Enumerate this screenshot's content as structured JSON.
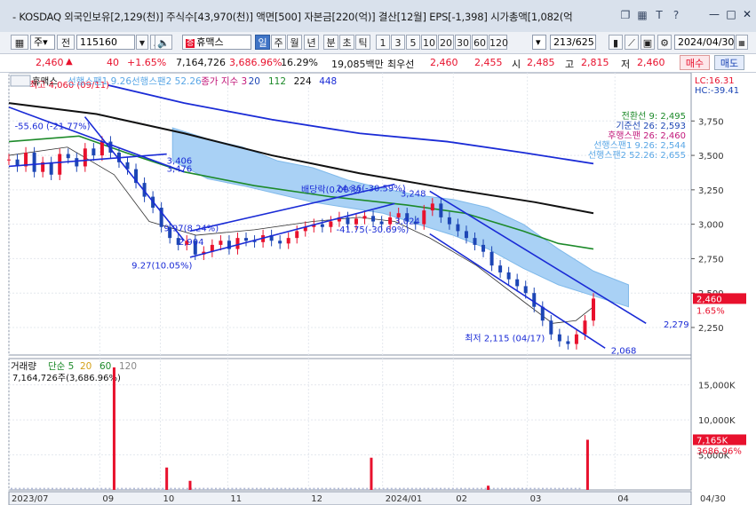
{
  "titlebar": {
    "text": "- KOSDAQ 외국인보유[2,129(천)] 주식수[43,970(천)] 액면[500] 자본금[220(억)] 결산[12월] EPS[-1,398] 시가총액[1,082(억",
    "icons": [
      "window-icon",
      "layout-icon",
      "text-icon",
      "help-icon"
    ]
  },
  "toolbar": {
    "type_select": "주",
    "jeon_label": "전",
    "code_value": "115160",
    "stock_name": "휴맥스",
    "stock_badge": "증",
    "periods": [
      "일",
      "주",
      "월",
      "년",
      "분",
      "초",
      "틱"
    ],
    "selected_period": "일",
    "intervals": [
      "1",
      "3",
      "5",
      "10",
      "20",
      "30",
      "60",
      "120"
    ],
    "counter": "213/625",
    "date_value": "2024/04/30"
  },
  "pricebar": {
    "price": "2,460",
    "change": "40",
    "change_pct": "+1.65%",
    "volume": "7,164,726",
    "vol_ratio": "3,686.96%",
    "turnover": "16.29%",
    "amount": "19,085백만",
    "pref_label": "최우선",
    "ask": "2,460",
    "bid": "2,455",
    "open_label": "시",
    "open": "2,485",
    "high_label": "고",
    "high": "2,815",
    "low_label": "저",
    "low": "2,460",
    "buy_label": "매수",
    "sell_label": "매도"
  },
  "chart_data": [
    {
      "type": "line",
      "title": "휴맥스",
      "legend": [
        "선행스팬1 9.26",
        "선행스팬2 52.26",
        "종가 지수 3",
        "20",
        "112",
        "224",
        "448"
      ],
      "ichimoku_values": {
        "전환선 9": "2,495",
        "기준선 26": "2,593",
        "후행스팬 26": "2,460",
        "선행스팬1 9.26": "2,544",
        "선행스팬2 52.26": "2,655"
      },
      "lc": "LC:16.31",
      "hc": "HC:-39.41",
      "y_ticks": [
        "3,750",
        "3,500",
        "3,250",
        "3,000",
        "2,750",
        "2,500",
        "2,250"
      ],
      "ylim": [
        2050,
        4100
      ],
      "current_price_tag": "2,460",
      "current_pct_tag": "1.65%",
      "x_ticks": [
        "2023/07",
        "09",
        "10",
        "11",
        "12",
        "2024/01",
        "02",
        "03",
        "04",
        "04/30"
      ],
      "annotations": [
        "최고 4,060 (09/11)",
        "-55.60 (-21.77%)",
        "3,406",
        "3,476",
        "9.97(8.24%)",
        "2,904",
        "9.27(10.05%)",
        "배당락(0.00%)",
        "24.36(-30.59%)",
        "3,248",
        "-41.75(-30.69%)",
        "3,024",
        "최저 2,115 (04/17)",
        "2,279",
        "2,068"
      ],
      "close_series": [
        3470,
        3420,
        3520,
        3380,
        3450,
        3360,
        3510,
        3480,
        3420,
        3550,
        3500,
        3600,
        3520,
        3450,
        3400,
        3300,
        3200,
        3120,
        2980,
        2900,
        2850,
        2880,
        2780,
        2800,
        2850,
        2880,
        2820,
        2900,
        2880,
        2870,
        2920,
        2880,
        2860,
        2900,
        2950,
        2980,
        3000,
        2980,
        3020,
        3050,
        3000,
        3040,
        3060,
        3020,
        3000,
        3050,
        3080,
        3020,
        3000,
        3100,
        3150,
        3050,
        3000,
        2950,
        2900,
        2850,
        2800,
        2700,
        2650,
        2600,
        2550,
        2500,
        2400,
        2300,
        2200,
        2150,
        2130,
        2200,
        2300,
        2460
      ]
    },
    {
      "type": "bar",
      "title": "거래량",
      "legend": [
        "단순 5",
        "20",
        "60",
        "120"
      ],
      "info": "7,164,726주(3,686.96%)",
      "y_ticks": [
        "15,000K",
        "10,000K",
        "5,000K"
      ],
      "ylim": [
        0,
        18000
      ],
      "volume_tag": "7,165K",
      "volume_pct_tag": "3686.96%",
      "spikes": [
        {
          "x_index": 0.18,
          "value": 17500
        },
        {
          "x_index": 0.27,
          "value": 3200
        },
        {
          "x_index": 0.31,
          "value": 1300
        },
        {
          "x_index": 0.62,
          "value": 4600
        },
        {
          "x_index": 0.82,
          "value": 600
        },
        {
          "x_index": 0.99,
          "value": 7165
        }
      ]
    }
  ]
}
